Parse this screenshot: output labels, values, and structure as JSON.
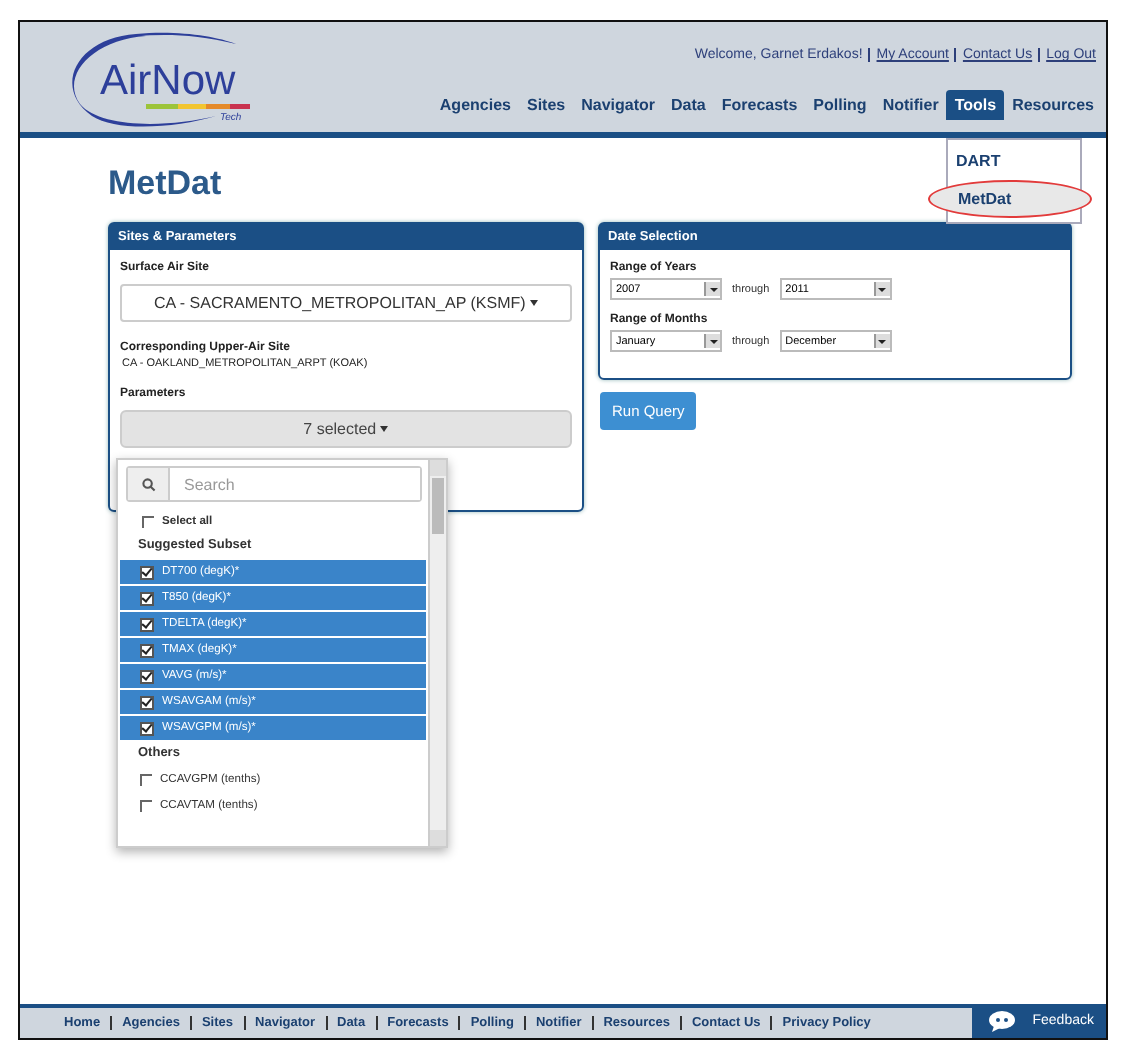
{
  "header": {
    "logo": {
      "name": "AirNow",
      "sub": "Tech"
    },
    "welcome": "Welcome, Garnet Erdakos!",
    "account_links": [
      "My Account",
      "Contact Us",
      "Log Out"
    ],
    "nav": [
      {
        "label": "Agencies",
        "selected": false
      },
      {
        "label": "Sites",
        "selected": false
      },
      {
        "label": "Navigator",
        "selected": false
      },
      {
        "label": "Data",
        "selected": false
      },
      {
        "label": "Forecasts",
        "selected": false
      },
      {
        "label": "Polling",
        "selected": false
      },
      {
        "label": "Notifier",
        "selected": false
      },
      {
        "label": "Tools",
        "selected": true
      },
      {
        "label": "Resources",
        "selected": false
      }
    ],
    "tools_menu": [
      {
        "label": "DART",
        "selected": false
      },
      {
        "label": "MetDat",
        "selected": true
      }
    ]
  },
  "page_title": "MetDat",
  "sites_panel": {
    "title": "Sites & Parameters",
    "surface_label": "Surface Air Site",
    "surface_value": "CA - SACRAMENTO_METROPOLITAN_AP (KSMF)",
    "upper_label": "Corresponding Upper-Air Site",
    "upper_value": "CA - OAKLAND_METROPOLITAN_ARPT (KOAK)",
    "parameters_label": "Parameters",
    "parameters_button": "7 selected"
  },
  "parameter_dropdown": {
    "search_placeholder": "Search",
    "select_all": {
      "label": "Select all",
      "checked": false
    },
    "groups": [
      {
        "heading": "Suggested Subset",
        "items": [
          {
            "label": "DT700 (degK)*",
            "checked": true
          },
          {
            "label": "T850 (degK)*",
            "checked": true
          },
          {
            "label": "TDELTA (degK)*",
            "checked": true
          },
          {
            "label": "TMAX (degK)*",
            "checked": true
          },
          {
            "label": "VAVG (m/s)*",
            "checked": true
          },
          {
            "label": "WSAVGAM (m/s)*",
            "checked": true
          },
          {
            "label": "WSAVGPM (m/s)*",
            "checked": true
          }
        ]
      },
      {
        "heading": "Others",
        "items": [
          {
            "label": "CCAVGPM (tenths)",
            "checked": false
          },
          {
            "label": "CCAVTAM (tenths)",
            "checked": false
          }
        ]
      }
    ]
  },
  "date_panel": {
    "title": "Date Selection",
    "years_label": "Range of Years",
    "year_from": "2007",
    "year_through": "through",
    "year_to": "2011",
    "months_label": "Range of Months",
    "month_from": "January",
    "month_through": "through",
    "month_to": "December"
  },
  "run_button": "Run Query",
  "footer": {
    "links": [
      "Home",
      "Agencies",
      "Sites",
      "Navigator",
      "Data",
      "Forecasts",
      "Polling",
      "Notifier",
      "Resources",
      "Contact Us",
      "Privacy Policy"
    ],
    "feedback": "Feedback"
  }
}
